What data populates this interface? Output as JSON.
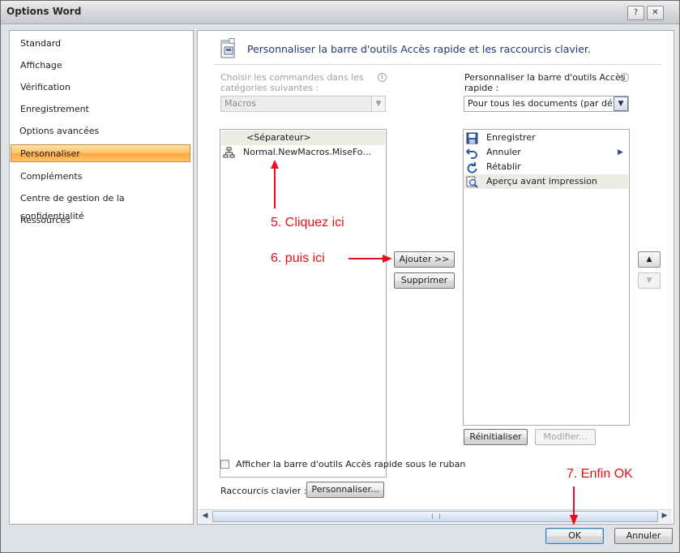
{
  "window": {
    "title": "Options Word",
    "help_glyph": "?",
    "close_glyph": "✕"
  },
  "nav": {
    "items": [
      {
        "label": "Standard",
        "active": false
      },
      {
        "label": "Affichage",
        "active": false
      },
      {
        "label": "Vérification",
        "active": false
      },
      {
        "label": "Enregistrement",
        "active": false
      },
      {
        "label": "Options avancées",
        "active": false
      },
      {
        "label": "Personnaliser",
        "active": true
      },
      {
        "label": "Compléments",
        "active": false
      },
      {
        "label": "Centre de gestion de la confidentialité",
        "active": false
      },
      {
        "label": "Ressources",
        "active": false
      }
    ]
  },
  "content": {
    "header": "Personnaliser la barre d'outils Accès rapide et les raccourcis clavier.",
    "left": {
      "label_line1": "Choisir les commandes dans les",
      "label_line2": "catégories suivantes :",
      "combo_value": "Macros",
      "items": [
        {
          "label": "<Séparateur>",
          "selected": true
        },
        {
          "label": "Normal.NewMacros.MiseFo...",
          "selected": false
        }
      ]
    },
    "right": {
      "label_line1": "Personnaliser la barre d'outils Accès",
      "label_line2": "rapide :",
      "combo_value": "Pour tous les documents (par dé...",
      "items": [
        {
          "label": "Enregistrer",
          "icon": "save-icon",
          "selected": false
        },
        {
          "label": "Annuler",
          "icon": "undo-icon",
          "selected": false
        },
        {
          "label": "Rétablir",
          "icon": "redo-icon",
          "selected": false
        },
        {
          "label": "Aperçu avant impression",
          "icon": "print-preview-icon",
          "selected": true
        }
      ]
    },
    "buttons": {
      "add": "Ajouter >>",
      "remove": "Supprimer",
      "reset": "Réinitialiser",
      "modify": "Modifier...",
      "customize": "Personnaliser..."
    },
    "checkbox_label": "Afficher la barre d'outils Accès rapide sous le ruban",
    "shortcuts_label": "Raccourcis clavier :"
  },
  "footer": {
    "ok": "OK",
    "cancel": "Annuler"
  },
  "annotations": {
    "step5": "5. Cliquez ici",
    "step6": "6. puis ici",
    "step7": "7. Enfin OK"
  },
  "colors": {
    "accent_red": "#e8101a",
    "active_nav": "#ffc064"
  }
}
